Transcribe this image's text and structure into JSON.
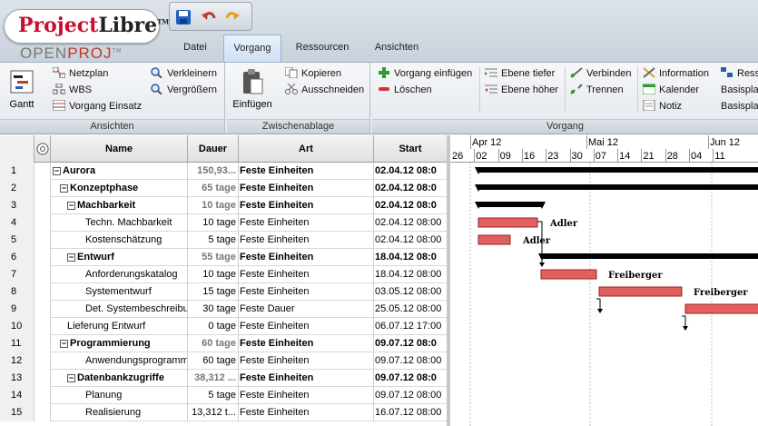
{
  "app": {
    "logo_main_1": "Project",
    "logo_main_2": "Libre",
    "logo_tm": "TM",
    "logo_sub_1": "OPEN",
    "logo_sub_2": "PROJ",
    "logo_sub_tm": "TM"
  },
  "quick_access": {
    "save": "save-icon",
    "undo": "undo-icon",
    "redo": "redo-icon"
  },
  "tabs": [
    {
      "label": "Datei"
    },
    {
      "label": "Vorgang",
      "active": true
    },
    {
      "label": "Ressourcen"
    },
    {
      "label": "Ansichten"
    }
  ],
  "ribbon": {
    "ansichten": {
      "label": "Ansichten",
      "gantt": "Gantt",
      "netzplan": "Netzplan",
      "wbs": "WBS",
      "vorgang_einsatz": "Vorgang Einsatz",
      "verkleinern": "Verkleinern",
      "vergroessern": "Vergrößern"
    },
    "zwischenablage": {
      "label": "Zwischenablage",
      "einfuegen": "Einfügen",
      "kopieren": "Kopieren",
      "ausschneiden": "Ausschneiden"
    },
    "vorgang": {
      "label": "Vorgang",
      "einfuegen": "Vorgang einfügen",
      "loeschen": "Löschen",
      "ebene_tiefer": "Ebene tiefer",
      "ebene_hoeher": "Ebene höher",
      "verbinden": "Verbinden",
      "trennen": "Trennen",
      "information": "Information",
      "kalender": "Kalender",
      "notiz": "Notiz",
      "ressourcen": "Ress",
      "basisplan1": "Basispla",
      "basisplan2": "Basispla"
    }
  },
  "table": {
    "headers": {
      "name": "Name",
      "dauer": "Dauer",
      "art": "Art",
      "start": "Start"
    },
    "rows": [
      {
        "num": "1",
        "name": "Aurora",
        "level": 0,
        "summary": true,
        "dauer": "150,93...",
        "dgrey": true,
        "art": "Feste Einheiten",
        "start": "02.04.12 08:0"
      },
      {
        "num": "2",
        "name": "Konzeptphase",
        "level": 1,
        "summary": true,
        "dauer": "65 tage",
        "dgrey": true,
        "art": "Feste Einheiten",
        "start": "02.04.12 08:0"
      },
      {
        "num": "3",
        "name": "Machbarkeit",
        "level": 2,
        "summary": true,
        "dauer": "10 tage",
        "dgrey": true,
        "art": "Feste Einheiten",
        "start": "02.04.12 08:0"
      },
      {
        "num": "4",
        "name": "Techn. Machbarkeit",
        "level": 3,
        "summary": false,
        "dauer": "10 tage",
        "art": "Feste Einheiten",
        "start": "02.04.12 08:00"
      },
      {
        "num": "5",
        "name": "Kostenschätzung",
        "level": 3,
        "summary": false,
        "dauer": "5 tage",
        "art": "Feste Einheiten",
        "start": "02.04.12 08:00"
      },
      {
        "num": "6",
        "name": "Entwurf",
        "level": 2,
        "summary": true,
        "dauer": "55 tage",
        "dgrey": true,
        "art": "Feste Einheiten",
        "start": "18.04.12 08:0"
      },
      {
        "num": "7",
        "name": "Anforderungskatalog",
        "level": 3,
        "summary": false,
        "dauer": "10 tage",
        "art": "Feste Einheiten",
        "start": "18.04.12 08:00"
      },
      {
        "num": "8",
        "name": "Systementwurf",
        "level": 3,
        "summary": false,
        "dauer": "15 tage",
        "art": "Feste Einheiten",
        "start": "03.05.12 08:00"
      },
      {
        "num": "9",
        "name": "Det. Systembeschreibu",
        "level": 3,
        "summary": false,
        "dauer": "30 tage",
        "art": "Feste Dauer",
        "start": "25.05.12 08:00"
      },
      {
        "num": "10",
        "name": "Lieferung Entwurf",
        "level": 2,
        "summary": false,
        "dauer": "0 tage",
        "art": "Feste Einheiten",
        "start": "06.07.12 17:00"
      },
      {
        "num": "11",
        "name": "Programmierung",
        "level": 1,
        "summary": true,
        "dauer": "60 tage",
        "dgrey": true,
        "art": "Feste Einheiten",
        "start": "09.07.12 08:0"
      },
      {
        "num": "12",
        "name": "Anwendungsprogramme",
        "level": 3,
        "summary": false,
        "dauer": "60 tage",
        "art": "Feste Einheiten",
        "start": "09.07.12 08:00"
      },
      {
        "num": "13",
        "name": "Datenbankzugriffe",
        "level": 2,
        "summary": true,
        "dauer": "38,312 ...",
        "dgrey": true,
        "art": "Feste Einheiten",
        "start": "09.07.12 08:0"
      },
      {
        "num": "14",
        "name": "Planung",
        "level": 3,
        "summary": false,
        "dauer": "5 tage",
        "art": "Feste Einheiten",
        "start": "09.07.12 08:00"
      },
      {
        "num": "15",
        "name": "Realisierung",
        "level": 3,
        "summary": false,
        "dauer": "13,312 t...",
        "art": "Feste Einheiten",
        "start": "16.07.12 08:00"
      }
    ]
  },
  "gantt": {
    "months": [
      {
        "label": "Apr 12"
      },
      {
        "label": "Mai 12"
      },
      {
        "label": "Jun 12"
      }
    ],
    "days": [
      "26",
      "02",
      "09",
      "16",
      "23",
      "30",
      "07",
      "14",
      "21",
      "28",
      "04",
      "11"
    ],
    "resources": {
      "adler": "Adler",
      "freiberger": "Freiberger"
    },
    "colors": {
      "task_fill": "#e06060",
      "summary": "#000000",
      "link": "#000000"
    }
  }
}
